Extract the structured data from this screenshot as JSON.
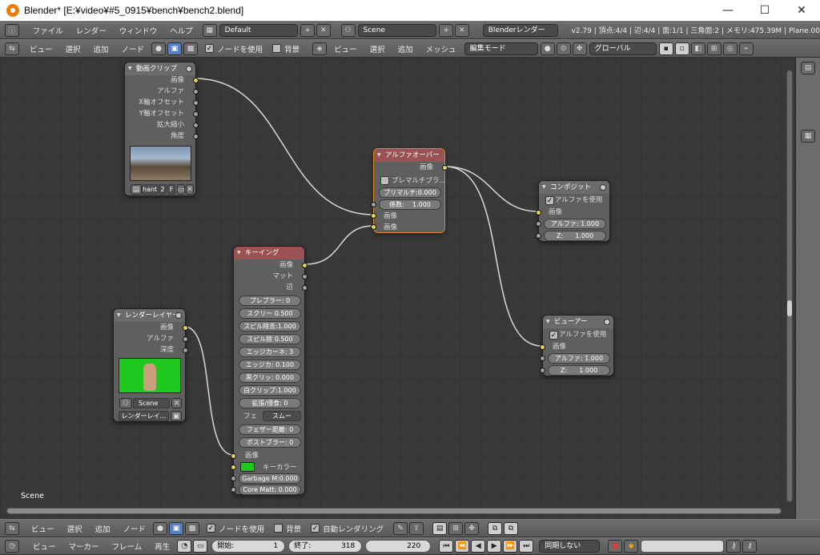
{
  "window": {
    "title": "Blender* [E:¥video¥#5_0915¥bench¥bench2.blend]",
    "minimize": "—",
    "maximize": "☐",
    "close": "✕"
  },
  "infobar": {
    "menus": [
      "ファイル",
      "レンダー",
      "ウィンドウ",
      "ヘルプ"
    ],
    "layout": "Default",
    "scene": "Scene",
    "engine": "Blenderレンダー",
    "stats": "v2.79 | 頂点:4/4 | 辺:4/4 | 面:1/1 | 三角面:2 | メモリ:475.39M | Plane.00"
  },
  "node_header": {
    "menus": [
      "ビュー",
      "選択",
      "追加",
      "ノード"
    ],
    "use_nodes": "ノードを使用",
    "backdrop": "背景",
    "view3d_menus": [
      "ビュー",
      "選択",
      "追加",
      "メッシュ"
    ],
    "mode": "編集モード",
    "orientation": "グローバル"
  },
  "nodes": {
    "movieclip": {
      "title": "動画クリップ",
      "outputs": [
        "画像",
        "アルファ",
        "X軸オフセット",
        "Y軸オフセット",
        "拡大縮小",
        "角度"
      ],
      "clip_name": "hant",
      "users": "2",
      "fake": "F"
    },
    "renderlayer": {
      "title": "レンダーレイヤー",
      "outputs": [
        "画像",
        "アルファ",
        "深度"
      ],
      "scene": "Scene",
      "layer": "レンダーレイ..."
    },
    "keying": {
      "title": "キーイング",
      "outputs": [
        "画像",
        "マット",
        "辺"
      ],
      "fields": [
        "プレブラー:",
        "0",
        "スクリー",
        "0.500",
        "スピル除去:1.000",
        "スピル除",
        "0.500",
        "エッジカーネ:",
        "3",
        "エッジカ:",
        "0.100",
        "黒クリッ:",
        "0.000",
        "白クリップ:1.000",
        "拡張/侵食:",
        "0"
      ],
      "feather_label": "フェ",
      "feather_value": "スムー",
      "feather_dist": "フェザー距離:",
      "feather_dist_val": "0",
      "postblur": "ポストブラー:",
      "postblur_val": "0",
      "in_image": "画像",
      "keycolor": "キーカラー",
      "garbage": "Garbage M:0.000",
      "coremat": "Core Matt: 0.000"
    },
    "alphaover": {
      "title": "アルファオーバー",
      "out": "画像",
      "premul": "プレマルチプラ...",
      "premul_val": "プリマルチ:0.000",
      "fac": "係数:",
      "fac_val": "1.000",
      "in1": "画像",
      "in2": "画像"
    },
    "composite": {
      "title": "コンポジット",
      "use_alpha": "アルファを使用",
      "in_image": "画像",
      "alpha": "アルファ:",
      "alpha_val": "1.000",
      "z": "Z:",
      "z_val": "1.000"
    },
    "viewer": {
      "title": "ビューアー",
      "use_alpha": "アルファを使用",
      "in_image": "画像",
      "alpha": "アルファ:",
      "alpha_val": "1.000",
      "z": "Z:",
      "z_val": "1.000"
    }
  },
  "editor": {
    "scene_label": "Scene"
  },
  "bottom_node_header": {
    "menus": [
      "ビュー",
      "選択",
      "追加",
      "ノード"
    ],
    "use_nodes": "ノードを使用",
    "backdrop": "背景",
    "auto_render": "自動レンダリング"
  },
  "timeline": {
    "menus": [
      "ビュー",
      "マーカー",
      "フレーム",
      "再生"
    ],
    "start_label": "開始:",
    "start": "1",
    "end_label": "終了:",
    "end": "318",
    "current": "220",
    "sync": "同期しない"
  }
}
